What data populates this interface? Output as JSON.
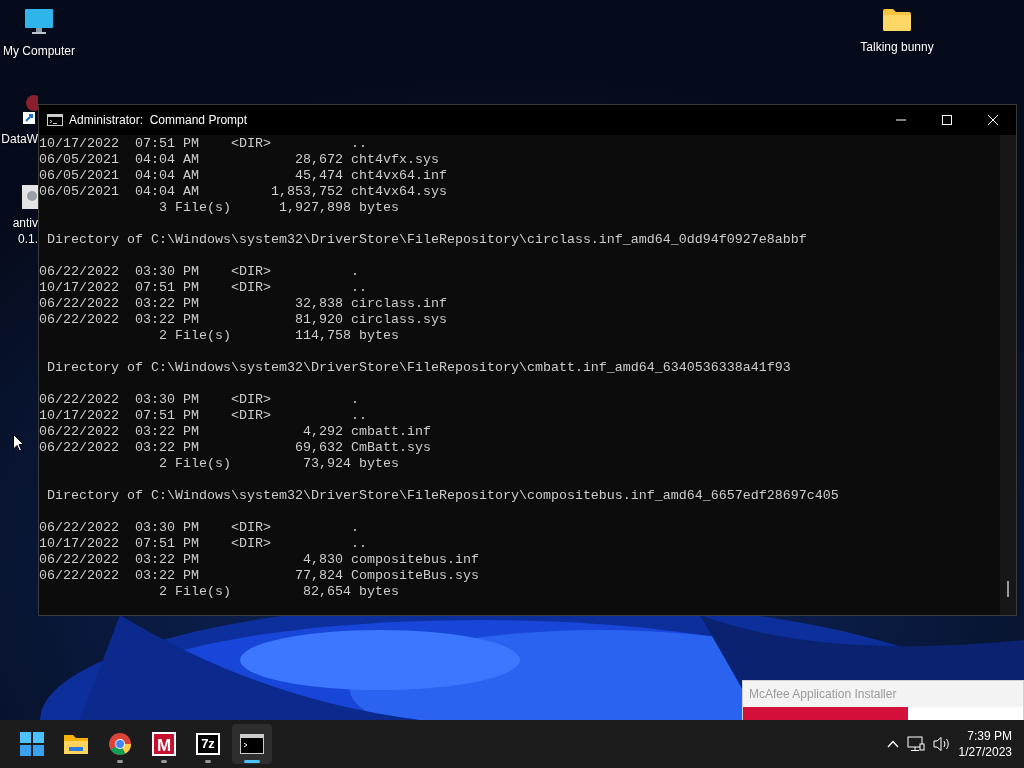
{
  "desktop": {
    "icons": [
      {
        "kind": "computer",
        "lines": [
          "My Computer"
        ]
      },
      {
        "kind": "shortcut",
        "lines": [
          "DataW"
        ]
      },
      {
        "kind": "app",
        "lines": [
          "antiv",
          "0.1."
        ]
      },
      {
        "kind": "folder",
        "lines": [
          "Talking bunny"
        ]
      }
    ]
  },
  "window": {
    "title": "Administrator:  Command Prompt",
    "console": {
      "blocks": [
        [
          "10/17/2022  07:51 PM    <DIR>          ..",
          "06/05/2021  04:04 AM            28,672 cht4vfx.sys",
          "06/05/2021  04:04 AM            45,474 cht4vx64.inf",
          "06/05/2021  04:04 AM         1,853,752 cht4vx64.sys",
          "               3 File(s)      1,927,898 bytes"
        ],
        [
          " Directory of C:\\Windows\\system32\\DriverStore\\FileRepository\\circlass.inf_amd64_0dd94f0927e8abbf"
        ],
        [
          "06/22/2022  03:30 PM    <DIR>          .",
          "10/17/2022  07:51 PM    <DIR>          ..",
          "06/22/2022  03:22 PM            32,838 circlass.inf",
          "06/22/2022  03:22 PM            81,920 circlass.sys",
          "               2 File(s)        114,758 bytes"
        ],
        [
          " Directory of C:\\Windows\\system32\\DriverStore\\FileRepository\\cmbatt.inf_amd64_6340536338a41f93"
        ],
        [
          "06/22/2022  03:30 PM    <DIR>          .",
          "10/17/2022  07:51 PM    <DIR>          ..",
          "06/22/2022  03:22 PM             4,292 cmbatt.inf",
          "06/22/2022  03:22 PM            69,632 CmBatt.sys",
          "               2 File(s)         73,924 bytes"
        ],
        [
          " Directory of C:\\Windows\\system32\\DriverStore\\FileRepository\\compositebus.inf_amd64_6657edf28697c405"
        ],
        [
          "06/22/2022  03:30 PM    <DIR>          .",
          "10/17/2022  07:51 PM    <DIR>          ..",
          "06/22/2022  03:22 PM             4,830 compositebus.inf",
          "06/22/2022  03:22 PM            77,824 CompositeBus.sys",
          "               2 File(s)         82,654 bytes"
        ]
      ]
    }
  },
  "popup": {
    "title": "McAfee Application Installer",
    "level": 0.59
  },
  "taskbar": {
    "apps": [
      {
        "kind": "folder",
        "running": false,
        "selected": false
      },
      {
        "kind": "chrome",
        "running": true,
        "selected": false
      },
      {
        "kind": "mcafee",
        "label": "M",
        "running": true,
        "selected": false
      },
      {
        "kind": "sevenzip",
        "label": "7z",
        "running": true,
        "selected": false
      },
      {
        "kind": "terminal",
        "running": true,
        "selected": true
      }
    ],
    "clock": {
      "time": "7:39 PM",
      "date": "1/27/2023"
    }
  }
}
